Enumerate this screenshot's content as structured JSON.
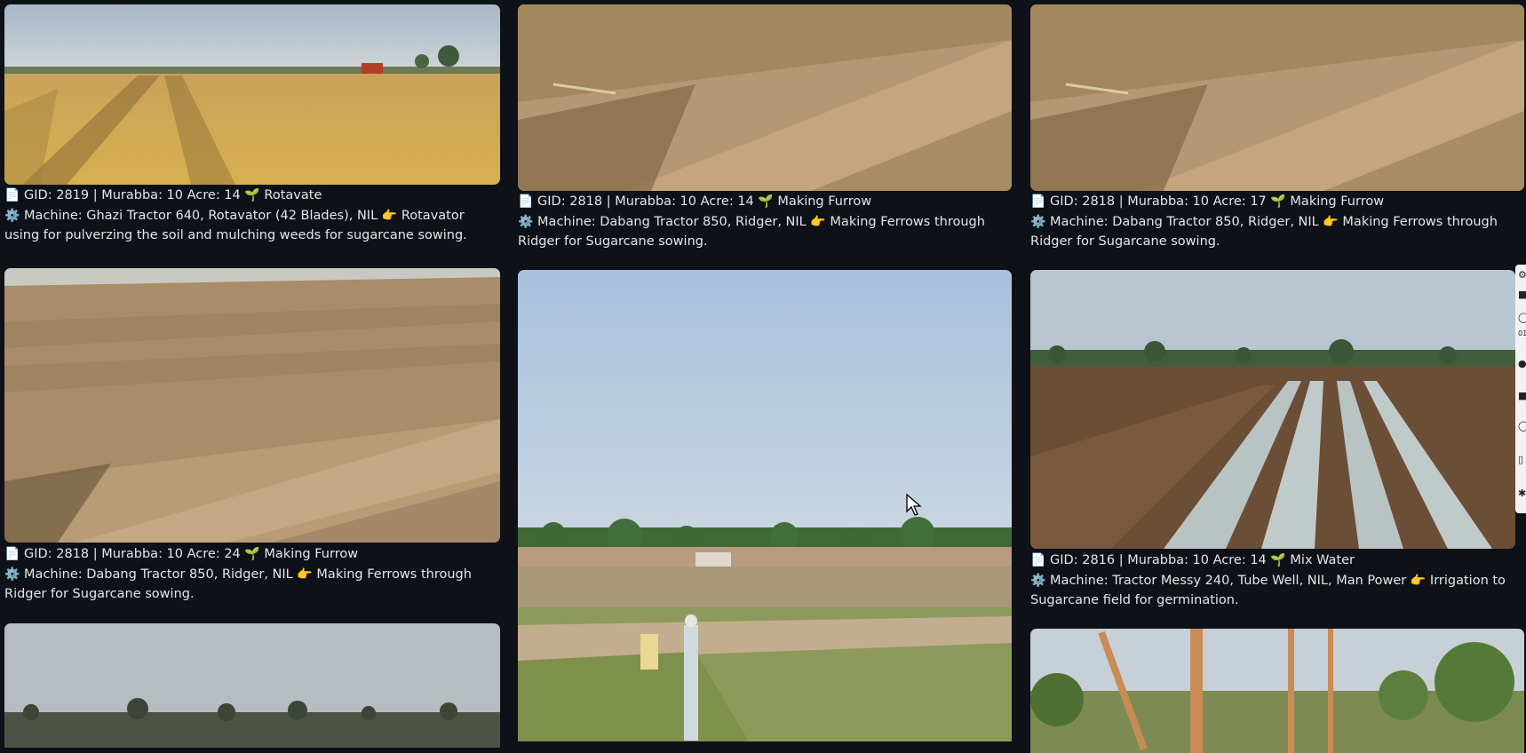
{
  "cards": [
    {
      "gid_line": "GID: 2819 | Murabba: 10 Acre: 14",
      "activity": "Rotavate",
      "machine_line": "Machine: Ghazi Tractor 640, Rotavator (42 Blades), NIL",
      "purpose_line": "Rotavator using for pulverzing the soil and mulching weeds for sugarcane sowing."
    },
    {
      "gid_line": "GID: 2818 | Murabba: 10 Acre: 14",
      "activity": "Making Furrow",
      "machine_line": "Machine: Dabang Tractor 850, Ridger, NIL",
      "purpose_line": "Making Ferrows through Ridger for Sugarcane sowing."
    },
    {
      "gid_line": "GID: 2818 | Murabba: 10 Acre: 17",
      "activity": "Making Furrow",
      "machine_line": "Machine: Dabang Tractor 850, Ridger, NIL",
      "purpose_line": "Making Ferrows through Ridger for Sugarcane sowing."
    },
    {
      "gid_line": "GID: 2818 | Murabba: 10 Acre: 24",
      "activity": "Making Furrow",
      "machine_line": "Machine: Dabang Tractor 850, Ridger, NIL",
      "purpose_line": "Making Ferrows through Ridger for Sugarcane sowing."
    },
    {
      "gid_line": "GID: 2816 | Murabba: 10 Acre: 14",
      "activity": "Mix Water",
      "machine_line": "Machine: Tractor Messy 240, Tube Well, NIL, Man Power",
      "purpose_line": "Irrigation to Sugarcane field for germination."
    }
  ],
  "icons": {
    "record": "clipboard-icon",
    "activity": "seedling-icon",
    "machine": "gear-icon",
    "purpose": "pointing-hand-icon"
  },
  "side_toolbar_glyph": "01"
}
